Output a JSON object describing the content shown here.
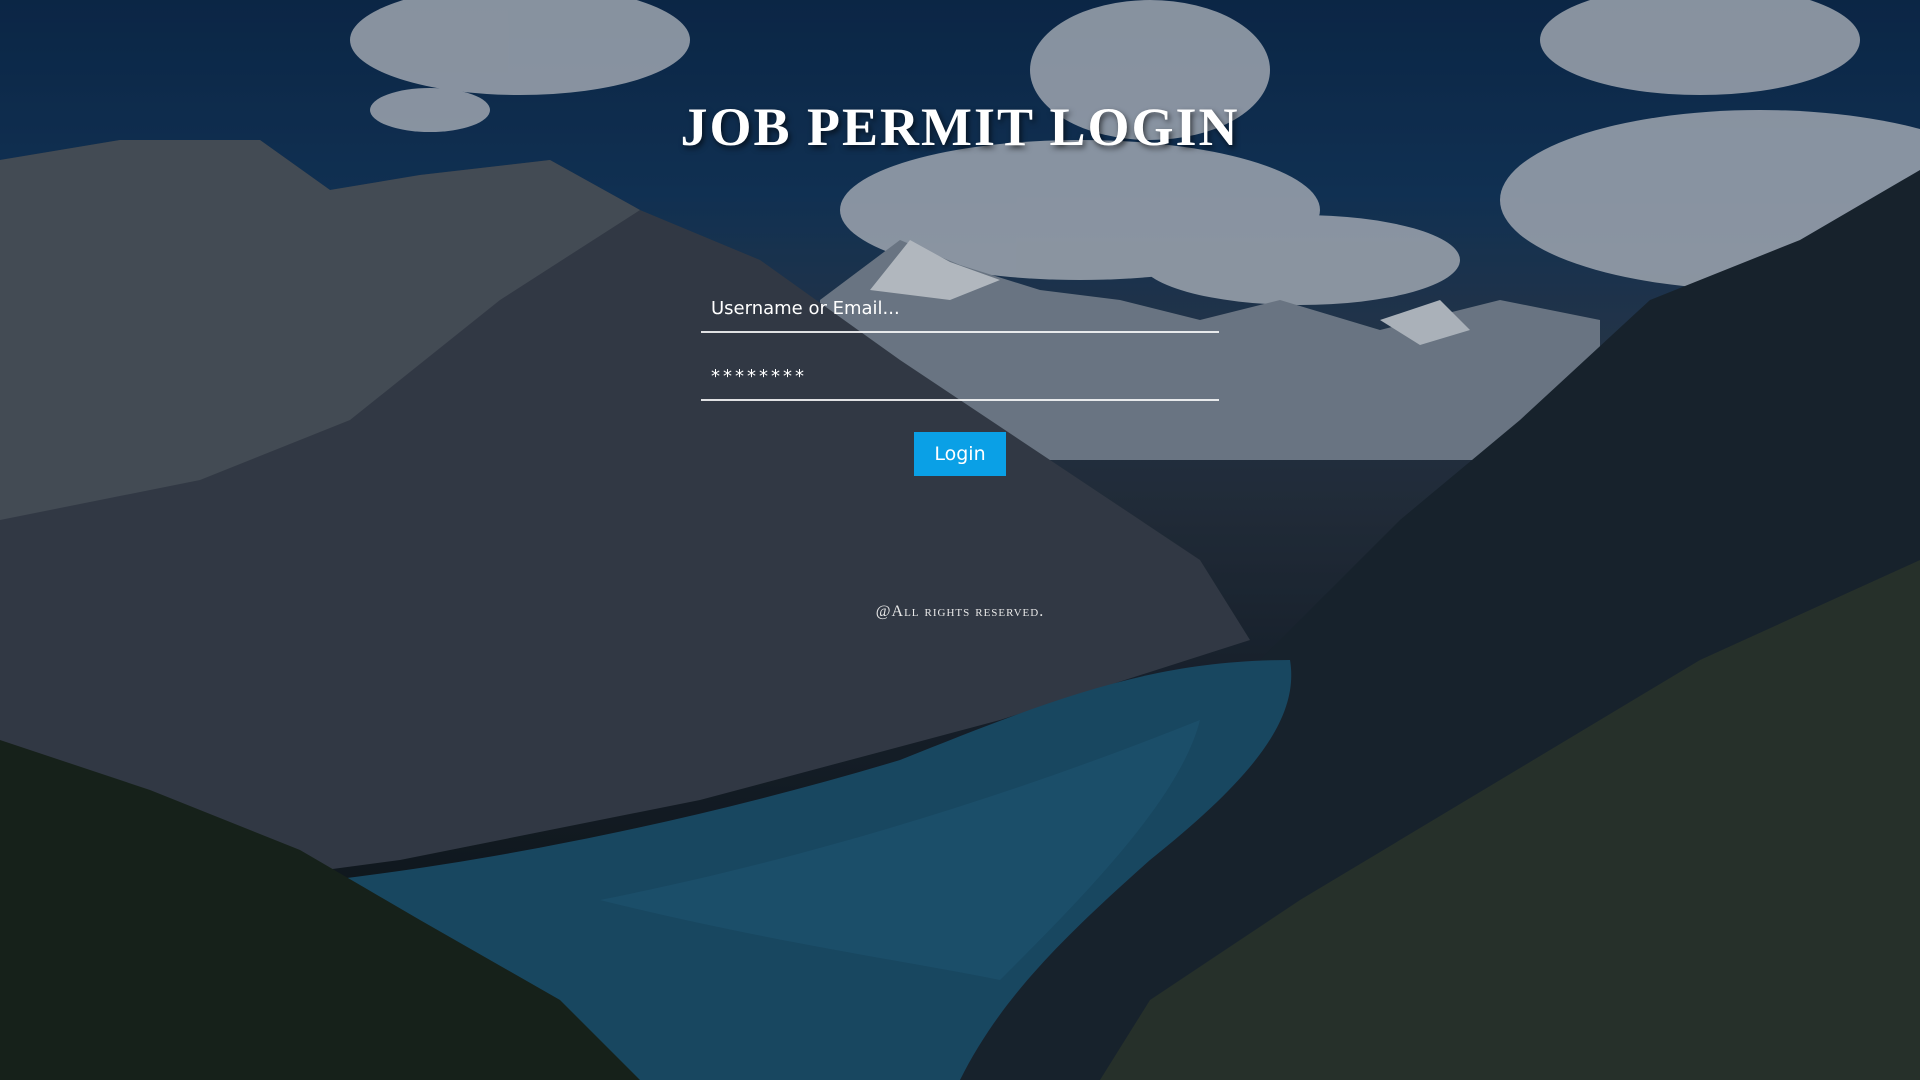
{
  "page": {
    "title": "JOB PERMIT LOGIN",
    "footer": "@All rights reserved."
  },
  "form": {
    "username_placeholder": "Username or Email...",
    "password_value": "********",
    "login_label": "Login"
  },
  "colors": {
    "accent": "#0aa0e6",
    "text": "#ffffff"
  }
}
